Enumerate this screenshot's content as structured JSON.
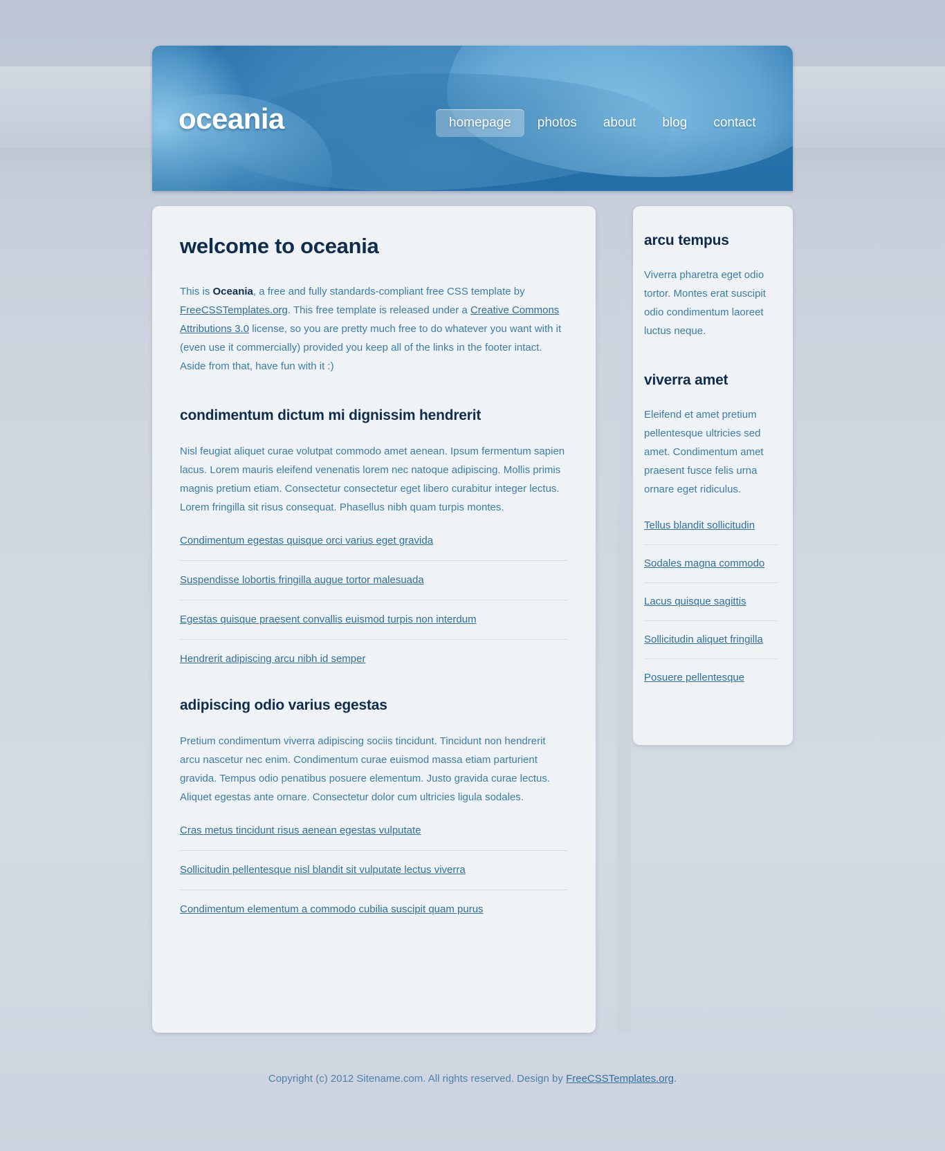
{
  "site": {
    "brand": "oceania"
  },
  "nav": {
    "items": [
      {
        "label": "homepage",
        "current": true
      },
      {
        "label": "photos",
        "current": false
      },
      {
        "label": "about",
        "current": false
      },
      {
        "label": "blog",
        "current": false
      },
      {
        "label": "contact",
        "current": false
      }
    ]
  },
  "main": {
    "title": "welcome to oceania",
    "intro": {
      "lead": "This is ",
      "brand_bold": "Oceania",
      "after_brand": ", a free and fully standards-compliant free CSS template by ",
      "link1": "FreeCSSTemplates.org",
      "middle": ". This free template is released under a ",
      "link2": "Creative Commons Attributions 3.0",
      "tail": " license, so you are pretty much free to do whatever you want with it (even use it commercially) provided you keep all of the links in the footer intact. Aside from that, have fun with it :)"
    },
    "sections": [
      {
        "heading": "condimentum dictum mi dignissim hendrerit",
        "body": "Nisl feugiat aliquet curae volutpat commodo amet aenean. Ipsum fermentum sapien lacus. Lorem mauris eleifend venenatis lorem nec natoque adipiscing. Mollis primis magnis pretium etiam. Consectetur consectetur eget libero curabitur integer lectus. Lorem fringilla sit risus consequat. Phasellus nibh quam turpis montes.",
        "links": [
          "Condimentum egestas quisque orci varius eget gravida",
          "Suspendisse lobortis fringilla augue tortor malesuada",
          "Egestas quisque praesent convallis euismod turpis non interdum",
          "Hendrerit adipiscing arcu nibh id semper"
        ]
      },
      {
        "heading": "adipiscing odio varius egestas",
        "body": "Pretium condimentum viverra adipiscing sociis tincidunt. Tincidunt non hendrerit arcu nascetur nec enim. Condimentum curae euismod massa etiam parturient gravida. Tempus odio penatibus posuere elementum. Justo gravida curae lectus. Aliquet egestas ante ornare. Consectetur dolor cum ultricies ligula sodales.",
        "links": [
          "Cras metus tincidunt risus aenean egestas vulputate",
          "Sollicitudin pellentesque nisl blandit sit vulputate lectus viverra",
          "Condimentum elementum a commodo cubilia suscipit quam purus"
        ]
      }
    ]
  },
  "sidebar": {
    "blocks": [
      {
        "heading": "arcu tempus",
        "body": "Viverra pharetra eget odio tortor. Montes erat suscipit odio condimentum laoreet luctus neque.",
        "links": []
      },
      {
        "heading": "viverra amet",
        "body": "Eleifend et amet pretium pellentesque ultricies sed amet. Condimentum amet praesent fusce felis urna ornare eget ridiculus.",
        "links": [
          "Tellus blandit sollicitudin",
          "Sodales magna commodo",
          "Lacus quisque sagittis",
          "Sollicitudin aliquet fringilla",
          "Posuere pellentesque"
        ]
      }
    ]
  },
  "footer": {
    "text_before": "Copyright (c) 2012 Sitename.com. All rights reserved. Design by ",
    "link": "FreeCSSTemplates.org",
    "text_after": "."
  },
  "colors": {
    "header_blue": "#2a74ad",
    "header_light_blue": "#78b8e0",
    "panel_bg": "#eff3f6",
    "heading_navy": "#0e2c4d",
    "body_blue": "#3a7cab",
    "link_blue": "#2e6f9e",
    "page_bg": "#ced5df",
    "divider_bar": "#ced4de"
  }
}
